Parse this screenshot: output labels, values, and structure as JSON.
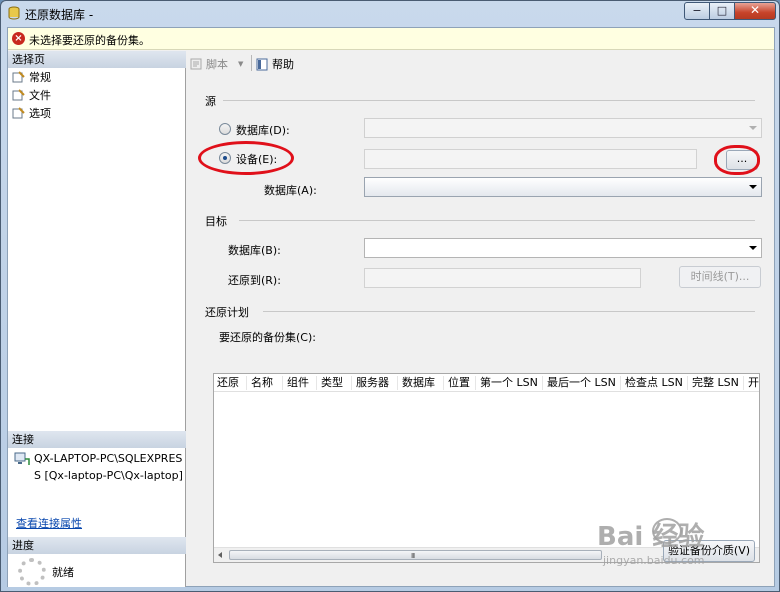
{
  "window": {
    "title": "还原数据库 -",
    "buttons": {
      "minimize": "−",
      "maximize": "□",
      "close": "✕"
    }
  },
  "error_bar": {
    "text": "未选择要还原的备份集。"
  },
  "left_pane": {
    "pages_header": "选择页",
    "pages": [
      {
        "label": "常规",
        "icon": "page-wrench-icon"
      },
      {
        "label": "文件",
        "icon": "page-wrench-icon"
      },
      {
        "label": "选项",
        "icon": "page-wrench-icon"
      }
    ],
    "connection_header": "连接",
    "connection_lines": [
      "QX-LAPTOP-PC\\SQLEXPRES",
      "S [Qx-laptop-PC\\Qx-laptop]"
    ],
    "connection_link": "查看连接属性",
    "progress_header": "进度",
    "progress_status": "就绪"
  },
  "toolbar": {
    "script_label": "脚本",
    "help_label": "帮助"
  },
  "source": {
    "group_label": "源",
    "database_radio": "数据库(D):",
    "device_radio": "设备(E):",
    "selected": "device",
    "browse_button": "...",
    "device_database_label": "数据库(A):"
  },
  "target": {
    "group_label": "目标",
    "database_label": "数据库(B):",
    "restore_to_label": "还原到(R):",
    "timeline_button": "时间线(T)..."
  },
  "plan": {
    "group_label": "还原计划",
    "backup_sets_label": "要还原的备份集(C):",
    "columns": [
      "还原",
      "名称",
      "组件",
      "类型",
      "服务器",
      "数据库",
      "位置",
      "第一个 LSN",
      "最后一个 LSN",
      "检查点 LSN",
      "完整 LSN",
      "开始"
    ],
    "verify_button": "验证备份介质(V)"
  },
  "watermark": {
    "brand": "Bai  经验",
    "url": "jingyan.baidu.com"
  },
  "colors": {
    "annotation": "#e0101a",
    "error_bg": "#ffffe1",
    "header_bg": "#c8d3e1"
  }
}
